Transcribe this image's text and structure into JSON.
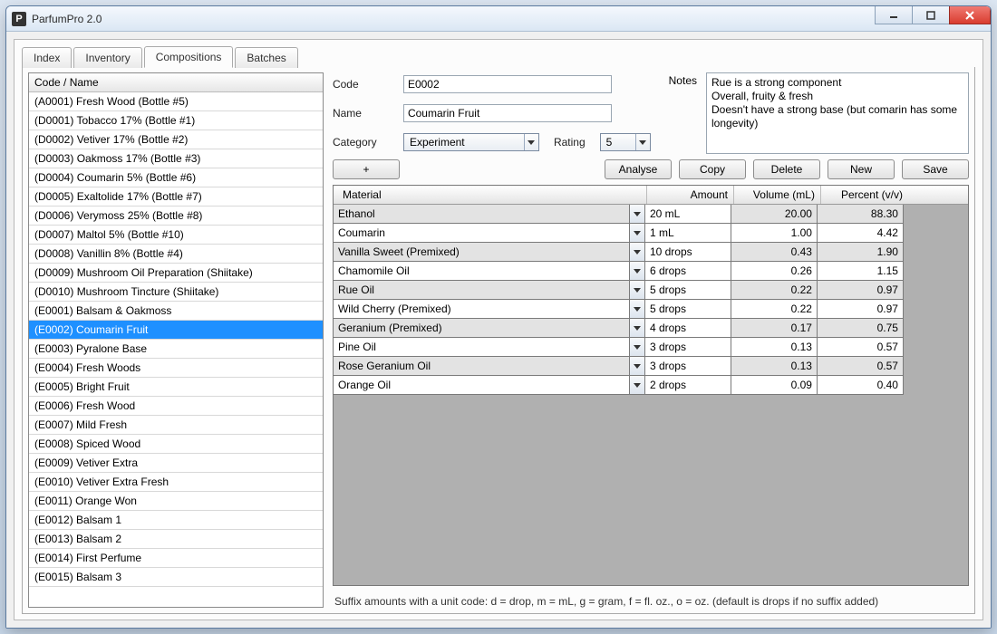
{
  "window": {
    "title": "ParfumPro 2.0",
    "app_icon_letter": "P"
  },
  "tabs": [
    {
      "label": "Index"
    },
    {
      "label": "Inventory"
    },
    {
      "label": "Compositions"
    },
    {
      "label": "Batches"
    }
  ],
  "active_tab_index": 2,
  "list_header": "Code / Name",
  "list_items": [
    "(A0001) Fresh Wood (Bottle #5)",
    "(D0001) Tobacco 17% (Bottle #1)",
    "(D0002) Vetiver 17% (Bottle #2)",
    "(D0003) Oakmoss 17% (Bottle #3)",
    "(D0004) Coumarin 5% (Bottle #6)",
    "(D0005) Exaltolide 17% (Bottle #7)",
    "(D0006) Verymoss 25% (Bottle #8)",
    "(D0007) Maltol 5% (Bottle #10)",
    "(D0008) Vanillin 8% (Bottle #4)",
    "(D0009) Mushroom Oil Preparation (Shiitake)",
    "(D0010) Mushroom Tincture (Shiitake)",
    "(E0001) Balsam & Oakmoss",
    "(E0002) Coumarin Fruit",
    "(E0003) Pyralone Base",
    "(E0004) Fresh Woods",
    "(E0005) Bright Fruit",
    "(E0006) Fresh Wood",
    "(E0007) Mild Fresh",
    "(E0008) Spiced Wood",
    "(E0009) Vetiver Extra",
    "(E0010) Vetiver Extra Fresh",
    "(E0011) Orange Won",
    "(E0012) Balsam 1",
    "(E0013) Balsam 2",
    "(E0014) First Perfume",
    "(E0015) Balsam 3"
  ],
  "selected_list_index": 12,
  "form": {
    "labels": {
      "code": "Code",
      "name": "Name",
      "category": "Category",
      "rating": "Rating",
      "notes": "Notes"
    },
    "code": "E0002",
    "name": "Coumarin Fruit",
    "category": "Experiment",
    "rating": "5",
    "notes": "Rue is a strong component\nOverall, fruity & fresh\nDoesn't have a strong base (but comarin has some longevity)"
  },
  "buttons": {
    "add": "+",
    "analyse": "Analyse",
    "copy": "Copy",
    "delete": "Delete",
    "new": "New",
    "save": "Save"
  },
  "grid": {
    "headers": {
      "material": "Material",
      "amount": "Amount",
      "volume": "Volume (mL)",
      "percent": "Percent (v/v)"
    },
    "rows": [
      {
        "material": "Ethanol",
        "amount": "20 mL",
        "volume": "20.00",
        "percent": "88.30"
      },
      {
        "material": "Coumarin",
        "amount": "1 mL",
        "volume": "1.00",
        "percent": "4.42"
      },
      {
        "material": "Vanilla Sweet (Premixed)",
        "amount": "10 drops",
        "volume": "0.43",
        "percent": "1.90"
      },
      {
        "material": "Chamomile Oil",
        "amount": "6 drops",
        "volume": "0.26",
        "percent": "1.15"
      },
      {
        "material": "Rue Oil",
        "amount": "5 drops",
        "volume": "0.22",
        "percent": "0.97"
      },
      {
        "material": "Wild Cherry (Premixed)",
        "amount": "5 drops",
        "volume": "0.22",
        "percent": "0.97"
      },
      {
        "material": "Geranium (Premixed)",
        "amount": "4 drops",
        "volume": "0.17",
        "percent": "0.75"
      },
      {
        "material": "Pine Oil",
        "amount": "3 drops",
        "volume": "0.13",
        "percent": "0.57"
      },
      {
        "material": "Rose Geranium Oil",
        "amount": "3 drops",
        "volume": "0.13",
        "percent": "0.57"
      },
      {
        "material": "Orange Oil",
        "amount": "2 drops",
        "volume": "0.09",
        "percent": "0.40"
      }
    ]
  },
  "footer_hint": "Suffix amounts with a unit code: d = drop, m = mL, g = gram, f = fl. oz., o = oz. (default is drops if no suffix added)"
}
